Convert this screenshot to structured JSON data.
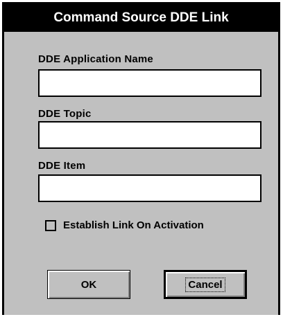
{
  "dialog": {
    "title": "Command Source DDE Link",
    "fields": [
      {
        "label": "DDE Application Name",
        "value": ""
      },
      {
        "label": "DDE Topic",
        "value": ""
      },
      {
        "label": "DDE Item",
        "value": ""
      }
    ],
    "checkbox": {
      "label": "Establish Link On Activation",
      "checked": false
    },
    "buttons": {
      "ok": "OK",
      "cancel": "Cancel"
    }
  }
}
